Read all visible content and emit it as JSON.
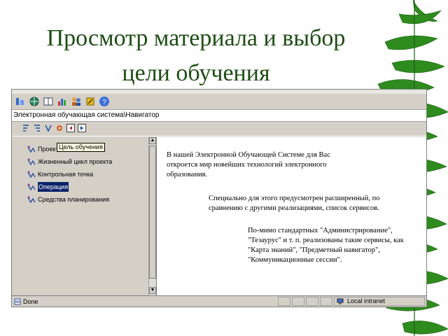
{
  "slide": {
    "title_line1": "Просмотр материала и выбор",
    "title_line2": "цели обучения"
  },
  "app": {
    "path": "Электронная обучающая система\\Навигатор",
    "toolbar_icons": [
      "module-icon",
      "globe-icon",
      "book-icon",
      "chart-icon",
      "users-icon",
      "tools-icon",
      "help-icon"
    ],
    "nav_icons": [
      "tree-icon-1",
      "tree-icon-2",
      "tree-icon-3",
      "target-icon",
      "back-icon",
      "forward-icon"
    ]
  },
  "tree": {
    "tooltip": "Цель обучения",
    "items": [
      {
        "label": "Проект"
      },
      {
        "label": "Жизненный цикл проекта"
      },
      {
        "label": "Контрольная точка"
      },
      {
        "label": "Операция",
        "selected": true
      },
      {
        "label": "Средства планирования"
      }
    ]
  },
  "content": {
    "para1": "В нашей Электронной Обучающей Системе для Вас откроется мир новейших технологий электронного образования.",
    "para2": "Специально для этого предусмотрен расширенный, по сравнению с другими реализациями, список сервисов.",
    "para3": "По-мимо стандартных \"Администрирование\", \"Тезаурус\" и т. п. реализованы такие сервисы, как \"Карта знаний\", \"Предметный навигатор\", \"Коммуникационные сессии\"."
  },
  "status": {
    "left": "Done",
    "zone": "Local intranet"
  },
  "colors": {
    "title": "#1e4d14",
    "selection": "#0a246a",
    "chrome": "#d4d0c8"
  }
}
